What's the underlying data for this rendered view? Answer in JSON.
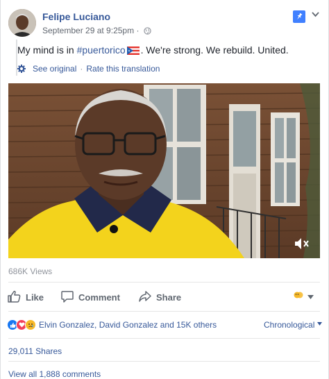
{
  "post": {
    "author": "Felipe Luciano",
    "date": "September 29 at 9:25pm",
    "dot": "·",
    "message_before": "My mind is in ",
    "hashtag": "#puertorico",
    "message_after": ". We're strong. We rebuild. United.",
    "see_original": "See original",
    "rate_translation": "Rate this translation",
    "separator": "·"
  },
  "video": {
    "views": "686K Views"
  },
  "actions": {
    "like": "Like",
    "comment": "Comment",
    "share": "Share"
  },
  "reactions": {
    "names": "Elvin Gonzalez, David Gonzalez and 15K others",
    "sort": "Chronological"
  },
  "stats": {
    "shares": "29,011 Shares",
    "view_comments": "View all 1,888 comments"
  },
  "colors": {
    "link": "#365899",
    "pin": "#4080ff",
    "like": "#1877f2",
    "love": "#f33e58",
    "shirt_yellow": "#f3d31c"
  },
  "icons": {
    "globe": "globe-icon",
    "pin": "pin-icon",
    "gear": "gear-icon",
    "mute": "mute-icon",
    "like": "thumbs-up-icon",
    "comment": "speech-bubble-icon",
    "share": "share-arrow-icon"
  }
}
